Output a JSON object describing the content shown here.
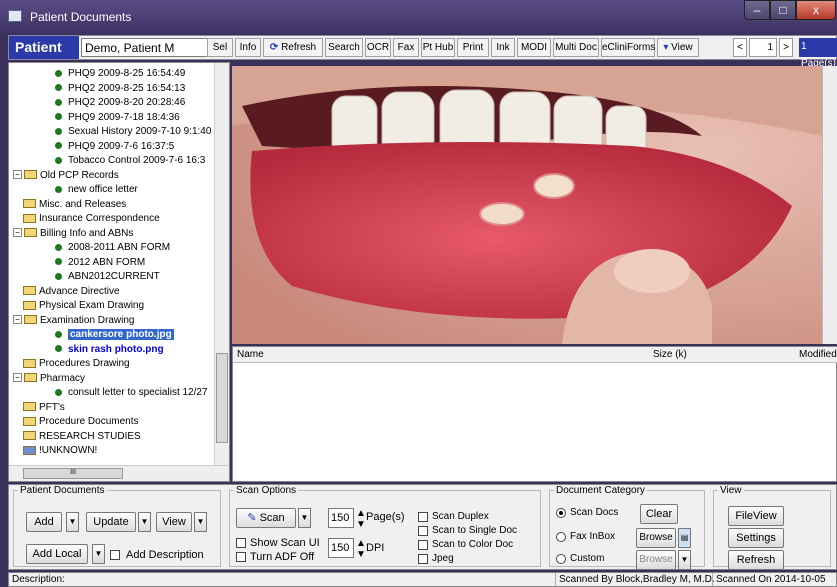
{
  "window": {
    "title": "Patient Documents",
    "minimize": "–",
    "maximize": "□",
    "close": "x"
  },
  "patient_bar": {
    "label": "Patient",
    "name": "Demo, Patient M",
    "buttons": [
      "Sel",
      "Info",
      "Refresh",
      "Search",
      "OCR",
      "Fax",
      "Pt Hub",
      "Print",
      "Ink",
      "MODI",
      "Multi Doc",
      "eCliniForms",
      "View"
    ],
    "page_prev": "<",
    "page_value": "1",
    "page_next": ">",
    "page_count": "1 Page(s)"
  },
  "tree": {
    "items": [
      {
        "text": "PHQ9 2009-8-25 16:54:49",
        "kind": "doc"
      },
      {
        "text": "PHQ2 2009-8-25 16:54:13",
        "kind": "doc"
      },
      {
        "text": "PHQ2 2009-8-20 20:28:46",
        "kind": "doc"
      },
      {
        "text": "PHQ9 2009-7-18 18:4:36",
        "kind": "doc"
      },
      {
        "text": "Sexual History 2009-7-10 9:1:40",
        "kind": "doc"
      },
      {
        "text": "PHQ9 2009-7-6 16:37:5",
        "kind": "doc"
      },
      {
        "text": "Tobacco Control 2009-7-6 16:3",
        "kind": "doc"
      },
      {
        "text": "Old PCP Records",
        "kind": "folder-open"
      },
      {
        "text": "new office letter",
        "kind": "doc"
      },
      {
        "text": "Misc. and Releases",
        "kind": "folder"
      },
      {
        "text": "Insurance Correspondence",
        "kind": "folder"
      },
      {
        "text": "Billing Info and ABNs",
        "kind": "folder-open"
      },
      {
        "text": "2008-2011 ABN FORM",
        "kind": "doc"
      },
      {
        "text": "2012 ABN FORM",
        "kind": "doc"
      },
      {
        "text": "ABN2012CURRENT",
        "kind": "doc"
      },
      {
        "text": "Advance Directive",
        "kind": "folder"
      },
      {
        "text": "Physical Exam Drawing",
        "kind": "folder"
      },
      {
        "text": "Examination Drawing",
        "kind": "folder-open"
      },
      {
        "text": "cankersore photo.jpg",
        "kind": "doc-selected"
      },
      {
        "text": "skin rash photo.png",
        "kind": "doc-bold"
      },
      {
        "text": "Procedures Drawing",
        "kind": "folder"
      },
      {
        "text": "Pharmacy",
        "kind": "folder-open"
      },
      {
        "text": "consult letter to specialist 12/27",
        "kind": "doc"
      },
      {
        "text": "PFT's",
        "kind": "folder"
      },
      {
        "text": "Procedure Documents",
        "kind": "folder"
      },
      {
        "text": "RESEARCH STUDIES",
        "kind": "folder"
      },
      {
        "text": "!UNKNOWN!",
        "kind": "special"
      }
    ],
    "hscroll_label": "III"
  },
  "filelist": {
    "col_name": "Name",
    "col_size": "Size (k)",
    "col_modified": "Modified"
  },
  "patient_documents": {
    "legend": "Patient Documents",
    "add": "Add",
    "update": "Update",
    "view": "View",
    "add_local": "Add Local",
    "add_description": "Add Description"
  },
  "scan_options": {
    "legend": "Scan Options",
    "scan": "Scan",
    "pages_value": "150",
    "pages_label": "Page(s)",
    "show_scan_ui": "Show Scan UI",
    "turn_adf_off": "Turn ADF Off",
    "dpi_value": "150",
    "dpi_label": "DPI",
    "scan_duplex": "Scan Duplex",
    "scan_single": "Scan to Single Doc",
    "scan_color": "Scan to Color Doc",
    "jpeg": "Jpeg"
  },
  "doc_category": {
    "legend": "Document Category",
    "scan_docs": "Scan Docs",
    "fax_inbox": "Fax InBox",
    "custom": "Custom",
    "clear": "Clear",
    "browse1": "Browse",
    "browse2": "Browse"
  },
  "view_group": {
    "legend": "View",
    "fileview": "FileView",
    "settings": "Settings",
    "refresh": "Refresh"
  },
  "status": {
    "description": "Description:",
    "scanned_by": "Scanned By Block,Bradley M, M.D.",
    "scanned_on": "Scanned On 2014-10-05"
  },
  "colors": {
    "accent": "#2b3aa8",
    "selection": "#3366cc",
    "doc_dot": "#1f7a1f"
  }
}
